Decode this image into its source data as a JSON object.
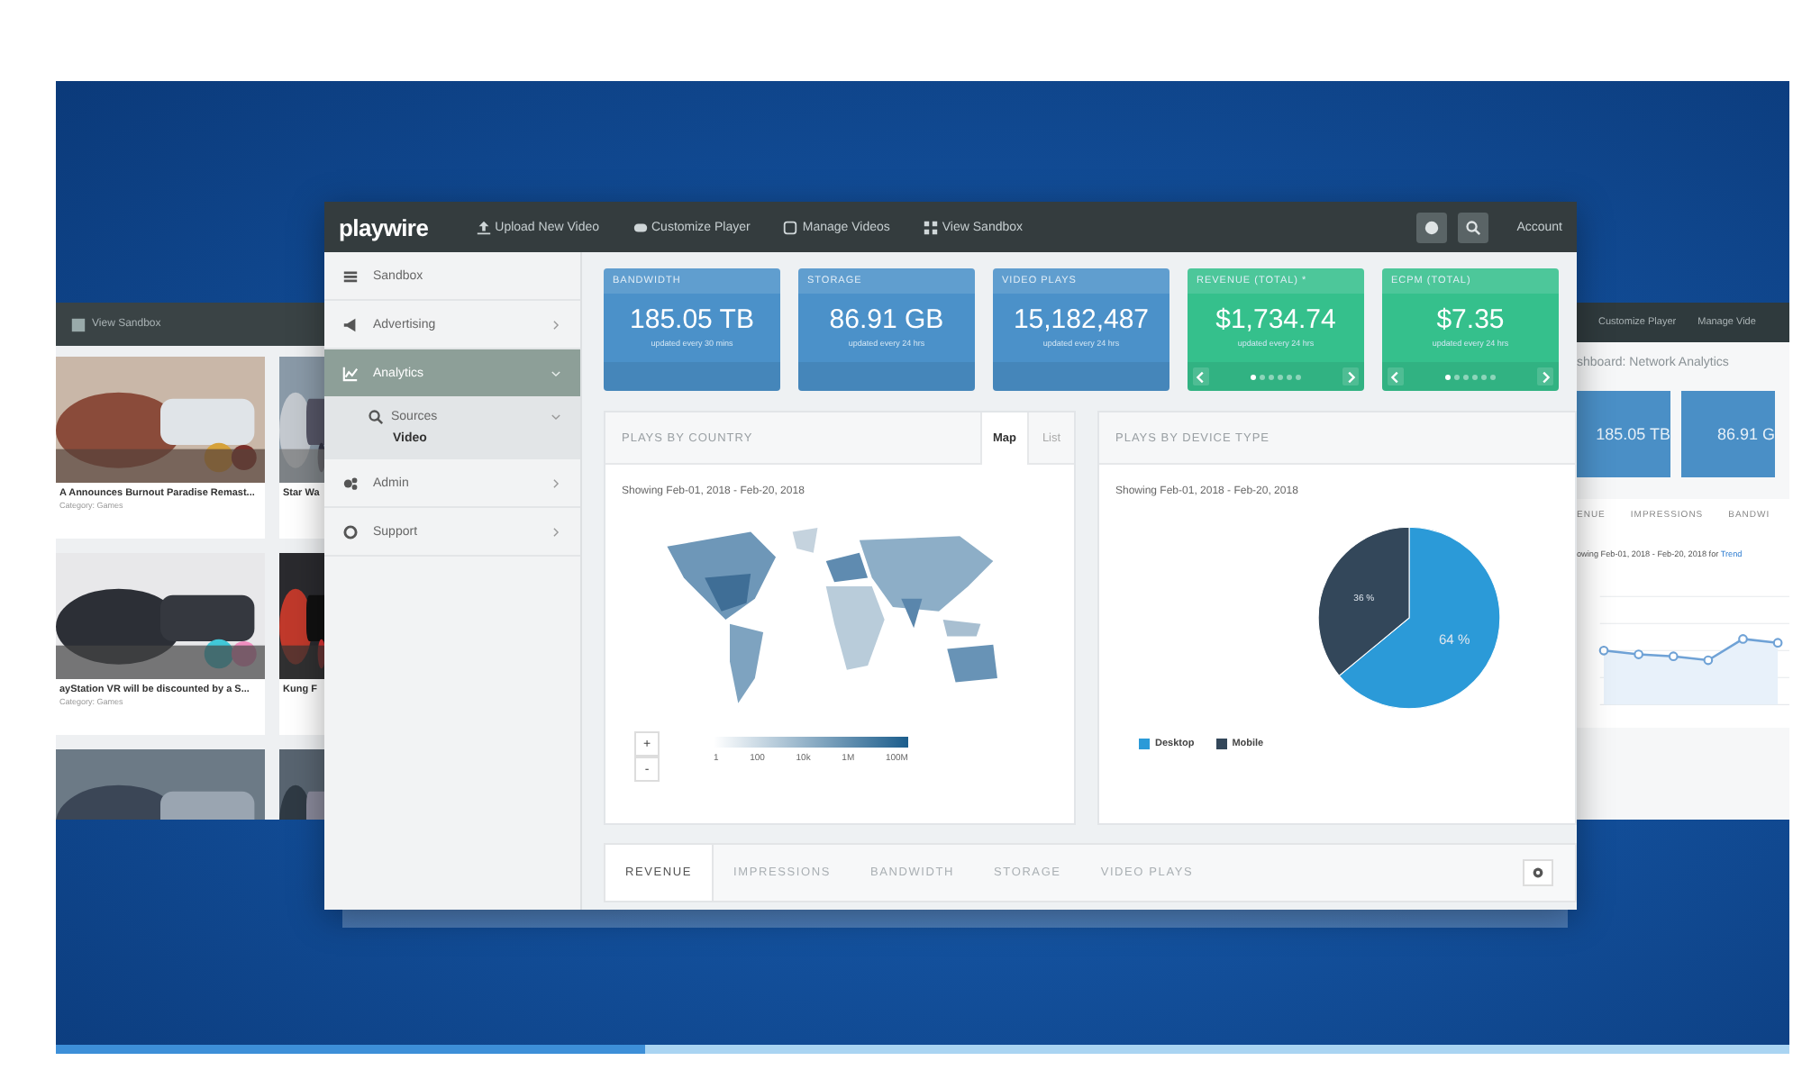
{
  "video": {
    "progress": {
      "level": 0.34
    }
  },
  "left_window": {
    "nav_item": "View Sandbox",
    "cards": [
      {
        "kind": "picture",
        "title": "A Announces Burnout Paradise Remast...",
        "meta": "Category: Games"
      },
      {
        "kind": "picture",
        "title": "Star Wa"
      },
      {
        "kind": "picture",
        "title": "ayStation VR will be discounted by a S...",
        "meta": "Category: Games"
      },
      {
        "kind": "picture",
        "title": "Kung F"
      },
      {
        "kind": "picture"
      },
      {
        "kind": "picture"
      }
    ]
  },
  "main_window": {
    "brand": "playwire",
    "nav": [
      "Upload New Video",
      "Customize Player",
      "Manage Videos",
      "View Sandbox"
    ],
    "account": "Account",
    "sidebar": [
      {
        "label": "Sandbox",
        "selected": false
      },
      {
        "label": "Advertising",
        "selected": false,
        "expanded": false
      },
      {
        "label": "Analytics",
        "selected": true,
        "expanded": true,
        "children": [
          {
            "label": "Sources",
            "expanded": true,
            "children": [
              {
                "label": "Video",
                "selected": true
              }
            ]
          }
        ]
      },
      {
        "label": "Admin",
        "selected": false,
        "expanded": false
      },
      {
        "label": "Support",
        "selected": false,
        "expanded": false
      }
    ],
    "kpis": [
      {
        "kind": "blue",
        "title": "BANDWIDTH",
        "value": "185.05 TB",
        "note": "updated every 30 mins"
      },
      {
        "kind": "blue",
        "title": "STORAGE",
        "value": "86.91 GB",
        "note": "updated every 24 hrs"
      },
      {
        "kind": "blue",
        "title": "VIDEO PLAYS",
        "value": "15,182,487",
        "note": "updated every 24 hrs"
      },
      {
        "kind": "green",
        "title": "REVENUE (TOTAL) *",
        "value": "$1,734.74",
        "note": "updated every 24 hrs",
        "dots": [
          {
            "selected": true
          },
          {
            "selected": false
          },
          {
            "selected": false
          },
          {
            "selected": false
          },
          {
            "selected": false
          },
          {
            "selected": false
          }
        ]
      },
      {
        "kind": "green",
        "title": "ECPM (TOTAL)",
        "value": "$7.35",
        "note": "updated every 24 hrs",
        "dots": [
          {
            "selected": true
          },
          {
            "selected": false
          },
          {
            "selected": false
          },
          {
            "selected": false
          },
          {
            "selected": false
          },
          {
            "selected": false
          }
        ]
      }
    ],
    "country_panel": {
      "title": "PLAYS BY COUNTRY",
      "tabs": [
        {
          "label": "Map",
          "selected": true
        },
        {
          "label": "List",
          "selected": false
        }
      ],
      "range": "Showing Feb-01, 2018 - Feb-20, 2018",
      "zoom": [
        "+",
        "-"
      ],
      "legend": [
        "1",
        "100",
        "10k",
        "1M",
        "100M"
      ]
    },
    "device_panel": {
      "title": "PLAYS BY DEVICE TYPE",
      "range": "Showing Feb-01, 2018 - Feb-20, 2018",
      "chart_data": {
        "type": "pie",
        "categories": [
          "Desktop",
          "Mobile"
        ],
        "values": [
          64,
          36
        ],
        "legend": "bottom",
        "value_labels": [
          "64 %",
          "36 %"
        ]
      }
    },
    "bottom_tabs": [
      {
        "label": "REVENUE",
        "selected": true
      },
      {
        "label": "IMPRESSIONS",
        "selected": false
      },
      {
        "label": "BANDWIDTH",
        "selected": false
      },
      {
        "label": "STORAGE",
        "selected": false
      },
      {
        "label": "VIDEO PLAYS",
        "selected": false
      }
    ]
  },
  "right_window": {
    "nav": [
      "Customize Player",
      "Manage Vide"
    ],
    "title": "shboard: Network Analytics",
    "cards": [
      "185.05 TB",
      "86.91 G"
    ],
    "tabs": [
      "ENUE",
      "IMPRESSIONS",
      "BANDWI"
    ],
    "range": "owing Feb-01, 2018 - Feb-20, 2018 for",
    "range_link": "Trend"
  }
}
